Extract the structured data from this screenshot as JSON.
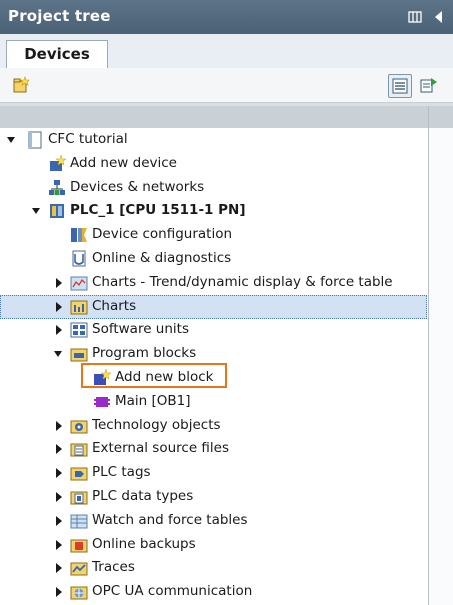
{
  "panel": {
    "title": "Project tree"
  },
  "tabs": [
    {
      "label": "Devices"
    }
  ],
  "colors": {
    "title_bar": "#4a6176",
    "selection": "#d3e1f5",
    "highlight_border": "#e8751a"
  },
  "tree": [
    {
      "label": "CFC tutorial",
      "level": 0,
      "expander": "expanded",
      "icon": "project-icon"
    },
    {
      "label": "Add new device",
      "level": 1,
      "expander": "none",
      "icon": "add-device-icon"
    },
    {
      "label": "Devices & networks",
      "level": 1,
      "expander": "none",
      "icon": "network-icon"
    },
    {
      "label": "PLC_1 [CPU 1511-1 PN]",
      "level": 1,
      "expander": "expanded",
      "icon": "plc-icon",
      "bold": true
    },
    {
      "label": "Device configuration",
      "level": 2,
      "expander": "none",
      "icon": "device-config-icon"
    },
    {
      "label": "Online & diagnostics",
      "level": 2,
      "expander": "none",
      "icon": "diagnostics-icon"
    },
    {
      "label": "Charts - Trend/dynamic display & force table",
      "level": 2,
      "expander": "collapsed",
      "icon": "chart-folder-icon"
    },
    {
      "label": "Charts",
      "level": 2,
      "expander": "collapsed",
      "icon": "charts-folder-icon",
      "selected": true
    },
    {
      "label": "Software units",
      "level": 2,
      "expander": "collapsed",
      "icon": "software-units-icon"
    },
    {
      "label": "Program blocks",
      "level": 2,
      "expander": "expanded",
      "icon": "program-blocks-icon"
    },
    {
      "label": "Add new block",
      "level": 3,
      "expander": "none",
      "icon": "add-block-icon",
      "highlighted": true
    },
    {
      "label": "Main [OB1]",
      "level": 3,
      "expander": "none",
      "icon": "ob-block-icon"
    },
    {
      "label": "Technology objects",
      "level": 2,
      "expander": "collapsed",
      "icon": "technology-icon"
    },
    {
      "label": "External source files",
      "level": 2,
      "expander": "collapsed",
      "icon": "source-files-icon"
    },
    {
      "label": "PLC tags",
      "level": 2,
      "expander": "collapsed",
      "icon": "plc-tags-icon"
    },
    {
      "label": "PLC data types",
      "level": 2,
      "expander": "collapsed",
      "icon": "data-types-icon"
    },
    {
      "label": "Watch and force tables",
      "level": 2,
      "expander": "collapsed",
      "icon": "watch-tables-icon"
    },
    {
      "label": "Online backups",
      "level": 2,
      "expander": "collapsed",
      "icon": "backups-icon"
    },
    {
      "label": "Traces",
      "level": 2,
      "expander": "collapsed",
      "icon": "traces-icon"
    },
    {
      "label": "OPC UA communication",
      "level": 2,
      "expander": "collapsed",
      "icon": "opc-ua-icon"
    }
  ]
}
